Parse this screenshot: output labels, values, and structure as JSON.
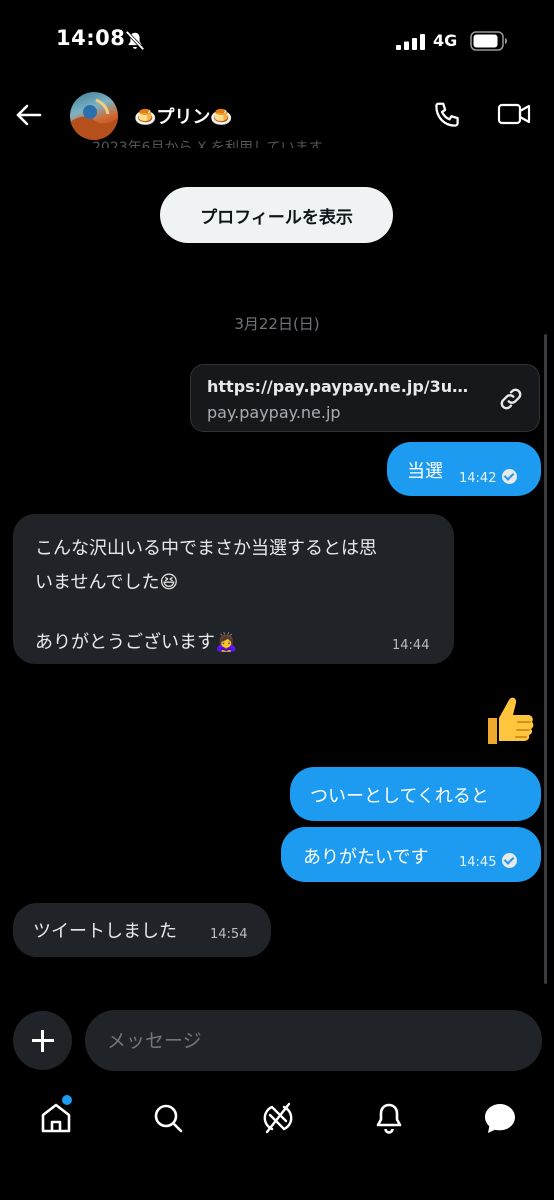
{
  "status_bar": {
    "time": "14:08",
    "network": "4G",
    "icons": [
      "bell-slash-icon",
      "signal-icon",
      "battery-icon"
    ]
  },
  "header": {
    "name": "🍮プリン🍮",
    "obscured_text": "2023年6月から X を利用しています",
    "icons": [
      "back-arrow-icon",
      "phone-icon",
      "video-icon"
    ]
  },
  "profile_button": {
    "label": "プロフィールを表示"
  },
  "date_separator": "3月22日(日)",
  "messages": {
    "link_card": {
      "url": "https://pay.paypay.ne.jp/3uv...",
      "domain": "pay.paypay.ne.jp",
      "icon": "link-icon"
    },
    "m1": {
      "text": "当選",
      "time": "14:42"
    },
    "m2": {
      "line1": "こんな沢山いる中でまさか当選するとは思",
      "line2": "いませんでした😆",
      "line3": "ありがとうございます🙇‍♀️",
      "time": "14:44"
    },
    "m_thumbs": "👍",
    "m3": {
      "text": "ついーとしてくれると"
    },
    "m4": {
      "text": "ありがたいです",
      "time": "14:45"
    },
    "m5": {
      "text": "ツイートしました",
      "time": "14:54"
    }
  },
  "composer": {
    "placeholder": "メッセージ"
  },
  "bottom_nav": [
    "home-icon",
    "search-icon",
    "grok-icon",
    "bell-icon",
    "messages-icon"
  ],
  "colors": {
    "accent": "#1d9bf0",
    "incoming_bubble": "#202327",
    "background": "#000000"
  }
}
